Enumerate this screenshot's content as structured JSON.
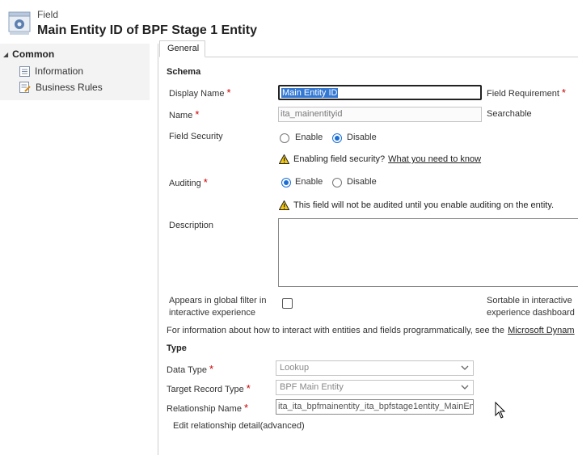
{
  "header": {
    "subtitle": "Field",
    "title": "Main Entity ID of BPF Stage 1 Entity"
  },
  "nav": {
    "section": "Common",
    "items": [
      {
        "label": "Information",
        "icon": "information-icon"
      },
      {
        "label": "Business Rules",
        "icon": "business-rules-icon"
      }
    ]
  },
  "tabs": [
    {
      "label": "General",
      "active": true
    }
  ],
  "schema": {
    "heading": "Schema",
    "display_name": {
      "label": "Display Name",
      "value": "Main Entity ID",
      "required": "*"
    },
    "field_requirement": {
      "label": "Field Requirement",
      "required": "*"
    },
    "name": {
      "label": "Name",
      "value": "ita_mainentityid",
      "required": "*"
    },
    "searchable": {
      "label": "Searchable"
    },
    "field_security": {
      "label": "Field Security",
      "options": [
        "Enable",
        "Disable"
      ],
      "selected": "Disable",
      "warning": "Enabling field security?",
      "warning_link": "What you need to know"
    },
    "auditing": {
      "label": "Auditing",
      "required": "*",
      "options": [
        "Enable",
        "Disable"
      ],
      "selected": "Enable",
      "warning": "This field will not be audited until you enable auditing on the entity."
    },
    "description": {
      "label": "Description",
      "value": ""
    },
    "global_filter": {
      "label_line1": "Appears in global filter in",
      "label_line2": "interactive experience",
      "checked": false
    },
    "sortable": {
      "label_line1": "Sortable in interactive",
      "label_line2": "experience dashboard"
    },
    "info_text": "For information about how to interact with entities and fields programmatically, see the",
    "info_link": "Microsoft Dynam"
  },
  "type": {
    "heading": "Type",
    "data_type": {
      "label": "Data Type",
      "required": "*",
      "value": "Lookup"
    },
    "target_record_type": {
      "label": "Target Record Type",
      "required": "*",
      "value": "BPF Main Entity"
    },
    "relationship_name": {
      "label": "Relationship Name",
      "required": "*",
      "value": "ita_ita_bpfmainentity_ita_bpfstage1entity_MainEn"
    },
    "edit_relationship": "Edit relationship detail(advanced)"
  },
  "colors": {
    "accent": "#1a6fd6",
    "required": "#cc0000",
    "selection": "#3478d1"
  }
}
